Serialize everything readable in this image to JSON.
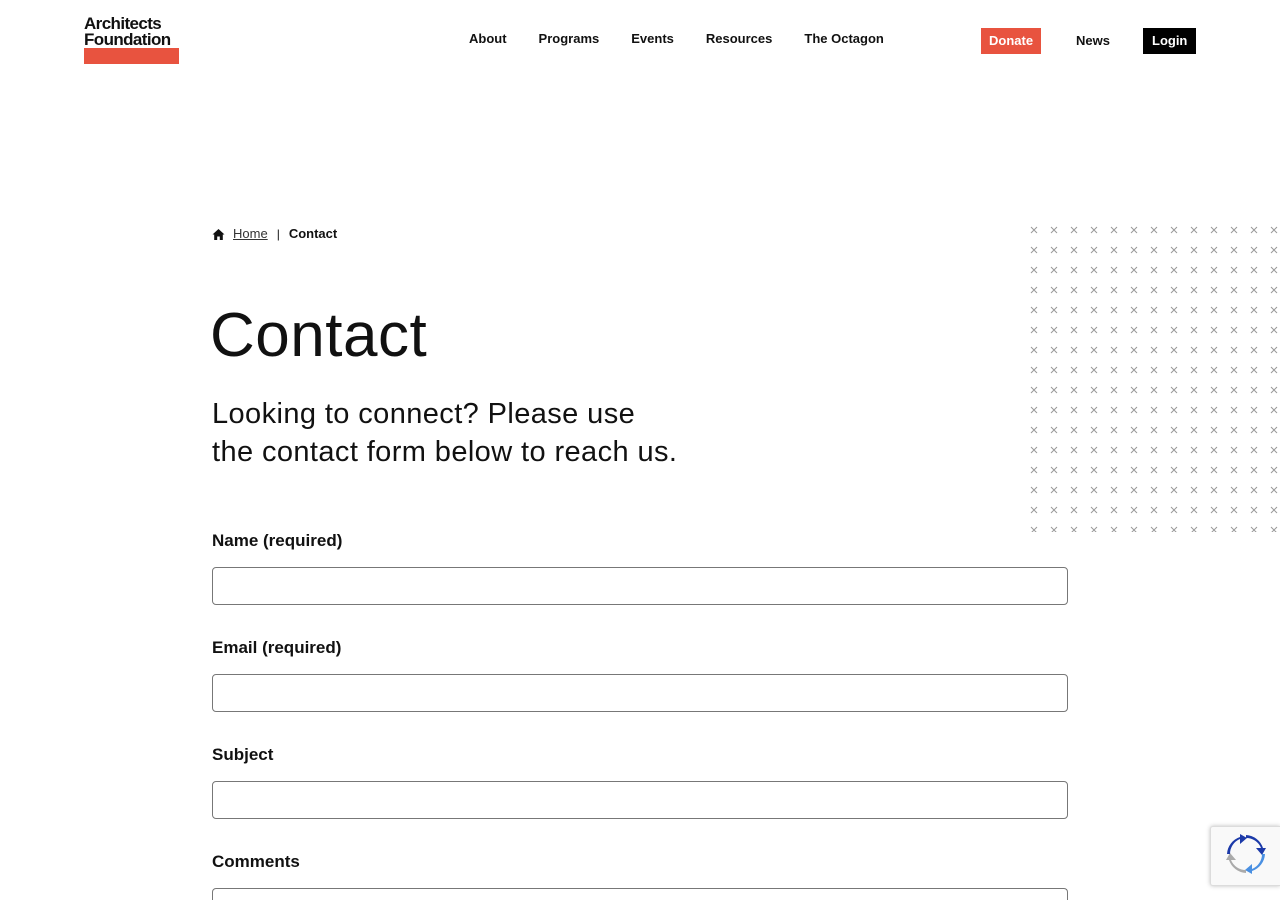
{
  "colors": {
    "brand_red": "#e8533f",
    "black": "#000000",
    "text": "#111111",
    "pattern_gray": "#9a9a9a"
  },
  "header": {
    "logo": {
      "line1": "Architects",
      "line2": "Foundation"
    },
    "nav": [
      {
        "label": "About"
      },
      {
        "label": "Programs"
      },
      {
        "label": "Events"
      },
      {
        "label": "Resources"
      },
      {
        "label": "The Octagon"
      }
    ],
    "donate_label": "Donate",
    "news_label": "News",
    "login_label": "Login"
  },
  "breadcrumb": {
    "home_icon": "home-icon",
    "home_label": "Home",
    "separator": "|",
    "current_label": "Contact"
  },
  "page": {
    "title": "Contact",
    "intro_line1": "Looking to connect? Please use",
    "intro_line2": "the contact form below to reach us."
  },
  "form": {
    "name_label": "Name (required)",
    "name_value": "",
    "email_label": "Email (required)",
    "email_value": "",
    "subject_label": "Subject",
    "subject_value": "",
    "comments_label": "Comments",
    "comments_value": ""
  },
  "decor": {
    "pattern_glyph": "×",
    "recaptcha_icon": "recaptcha-icon"
  }
}
